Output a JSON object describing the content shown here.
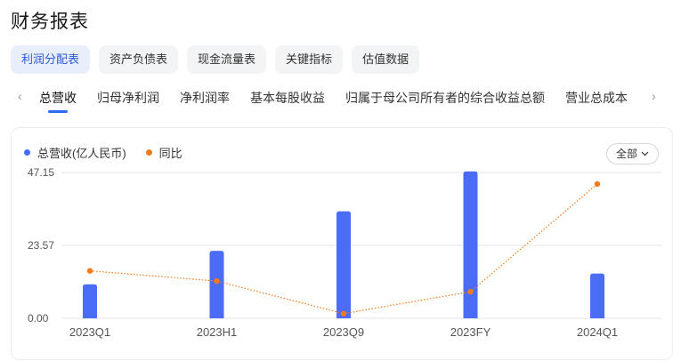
{
  "page": {
    "title": "财务报表"
  },
  "statement_tabs": [
    {
      "label": "利润分配表",
      "active": true
    },
    {
      "label": "资产负债表",
      "active": false
    },
    {
      "label": "现金流量表",
      "active": false
    },
    {
      "label": "关键指标",
      "active": false
    },
    {
      "label": "估值数据",
      "active": false
    }
  ],
  "metric_tabs": [
    {
      "label": "总营收",
      "active": true
    },
    {
      "label": "归母净利润",
      "active": false
    },
    {
      "label": "净利润率",
      "active": false
    },
    {
      "label": "基本每股收益",
      "active": false
    },
    {
      "label": "归属于母公司所有者的综合收益总额",
      "active": false
    },
    {
      "label": "营业总成本",
      "active": false
    }
  ],
  "icons": {
    "left_arrow": "chevron-left-icon",
    "right_arrow": "chevron-right-icon",
    "dropdown": "chevron-down-icon"
  },
  "range_select": {
    "value": "全部"
  },
  "colors": {
    "bar": "#4a6cf7",
    "line": "#f07a1c",
    "grid": "#e6e6e6",
    "axis_text": "#555555"
  },
  "chart_data": {
    "type": "bar",
    "categories": [
      "2023Q1",
      "2023H1",
      "2023Q9",
      "2023FY",
      "2024Q1"
    ],
    "series": [
      {
        "name": "总营收(亿人民币)",
        "type": "bar",
        "values": [
          11.0,
          21.8,
          34.6,
          47.5,
          14.5
        ]
      },
      {
        "name": "同比",
        "type": "line",
        "style": "dotted",
        "values": [
          18.2,
          14.3,
          1.8,
          10.2,
          51.5
        ]
      }
    ],
    "y_ticks": [
      "47.15",
      "23.57",
      "0.00"
    ],
    "ylim": [
      0,
      47.15
    ],
    "legend": "top-left",
    "grid": true
  }
}
